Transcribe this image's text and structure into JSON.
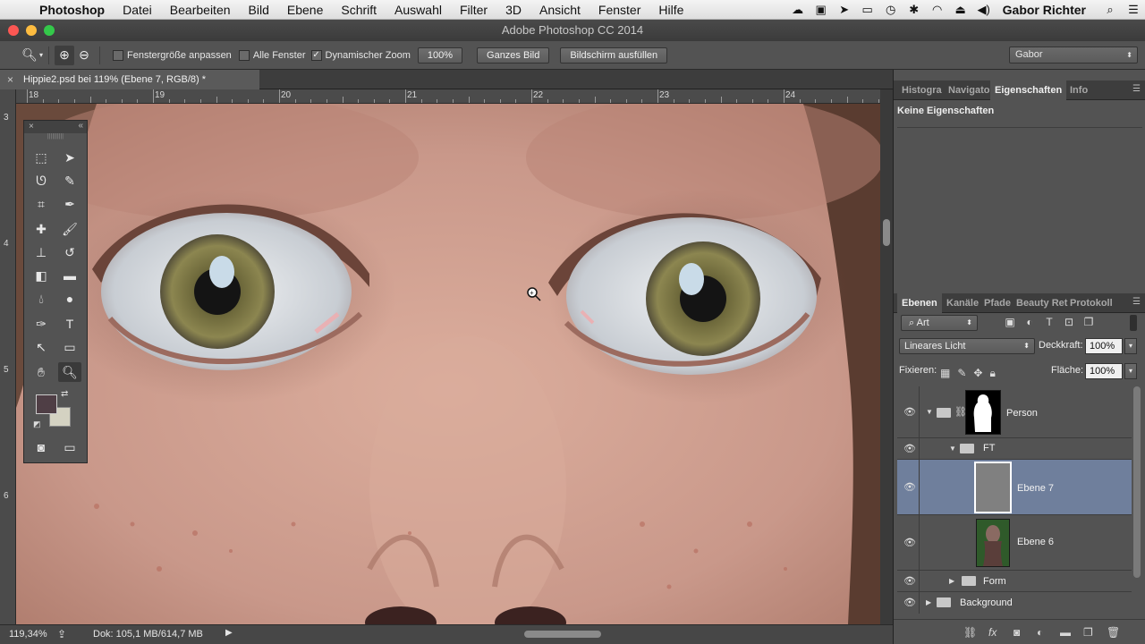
{
  "menubar": {
    "app": "Photoshop",
    "items": [
      "Datei",
      "Bearbeiten",
      "Bild",
      "Ebene",
      "Schrift",
      "Auswahl",
      "Filter",
      "3D",
      "Ansicht",
      "Fenster",
      "Hilfe"
    ],
    "user": "Gabor Richter",
    "tray_icons": [
      "cloud-icon",
      "screen-icon",
      "forward-icon",
      "airplay-icon",
      "time-machine-icon",
      "bluetooth-icon",
      "wifi-icon",
      "eject-icon",
      "volume-icon"
    ]
  },
  "window": {
    "title": "Adobe Photoshop CC 2014"
  },
  "options": {
    "checkbox_resize": "Fenstergröße anpassen",
    "checkbox_all_windows": "Alle Fenster",
    "checkbox_scrubby": "Dynamischer Zoom",
    "btn_100": "100%",
    "btn_fit": "Ganzes Bild",
    "btn_fill": "Bildschirm ausfüllen",
    "workspace": "Gabor"
  },
  "document": {
    "tab_title": "Hippie2.psd bei 119% (Ebene 7, RGB/8) *",
    "ruler_h": [
      "18",
      "19",
      "20",
      "21",
      "22",
      "23",
      "24"
    ],
    "ruler_v": [
      "3",
      "4",
      "5",
      "6"
    ]
  },
  "status": {
    "zoom": "119,34%",
    "doc_size": "Dok: 105,1 MB/614,7 MB"
  },
  "panels": {
    "top_tabs": [
      "Histogra",
      "Navigato",
      "Eigenschaften",
      "Info"
    ],
    "properties_text": "Keine Eigenschaften",
    "layer_tabs": [
      "Ebenen",
      "Kanäle",
      "Pfade",
      "Beauty Ret",
      "Protokoll"
    ],
    "filter_kind": "Art",
    "blend_mode": "Lineares Licht",
    "opacity_label": "Deckkraft:",
    "opacity_value": "100%",
    "lock_label": "Fixieren:",
    "fill_label": "Fläche:",
    "fill_value": "100%"
  },
  "layers": [
    {
      "name": "Person",
      "type": "group",
      "expanded": true
    },
    {
      "name": "FT",
      "type": "group",
      "expanded": true
    },
    {
      "name": "Ebene 7",
      "type": "layer",
      "selected": true
    },
    {
      "name": "Ebene 6",
      "type": "layer"
    },
    {
      "name": "Form",
      "type": "group",
      "expanded": false
    },
    {
      "name": "Background",
      "type": "group",
      "expanded": false
    }
  ],
  "colors": {
    "foreground": "#4f3e45",
    "background": "#d4d2c2",
    "selected_layer": "#6f7f9c"
  }
}
